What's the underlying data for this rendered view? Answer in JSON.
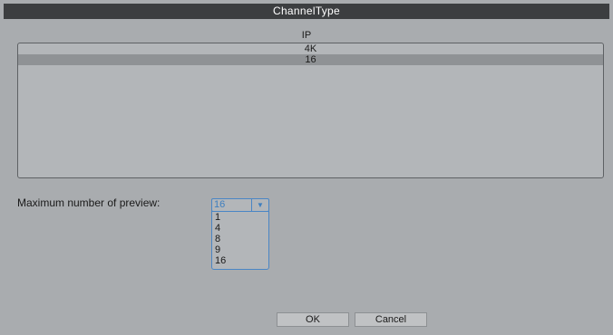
{
  "window": {
    "title": "ChannelType"
  },
  "list": {
    "header": "IP",
    "rows": [
      "4K",
      "16"
    ],
    "selected_index": 1
  },
  "preview": {
    "label": "Maximum number of preview:",
    "selected_value": "16",
    "options": [
      "1",
      "4",
      "8",
      "9",
      "16"
    ]
  },
  "buttons": {
    "ok_label": "OK",
    "cancel_label": "Cancel"
  },
  "colors": {
    "titlebar": "#3c3e40",
    "background": "#a9acaf",
    "select_accent": "#4a86c5",
    "selected_row": "#8f9295"
  },
  "icons": {
    "select_arrow": "chevron-down-icon"
  }
}
